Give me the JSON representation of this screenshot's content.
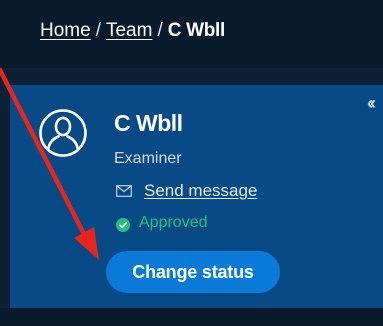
{
  "breadcrumb": {
    "home": "Home",
    "separator": "/",
    "team": "Team",
    "current": "C Wbll"
  },
  "member": {
    "name": "C Wbll",
    "role": "Examiner",
    "send_message": "Send message",
    "status": "Approved"
  },
  "actions": {
    "change_status": "Change status"
  },
  "icons": {
    "avatar": "user-avatar-icon",
    "mail": "envelope-icon",
    "status": "check-circle-icon",
    "collapse": "double-chevron-left-icon"
  },
  "colors": {
    "topbar": "#0a1b2e",
    "panel": "#074a86",
    "button": "#0b7ad6",
    "status_green": "#22c27a",
    "annotation_arrow": "#e8251c"
  }
}
